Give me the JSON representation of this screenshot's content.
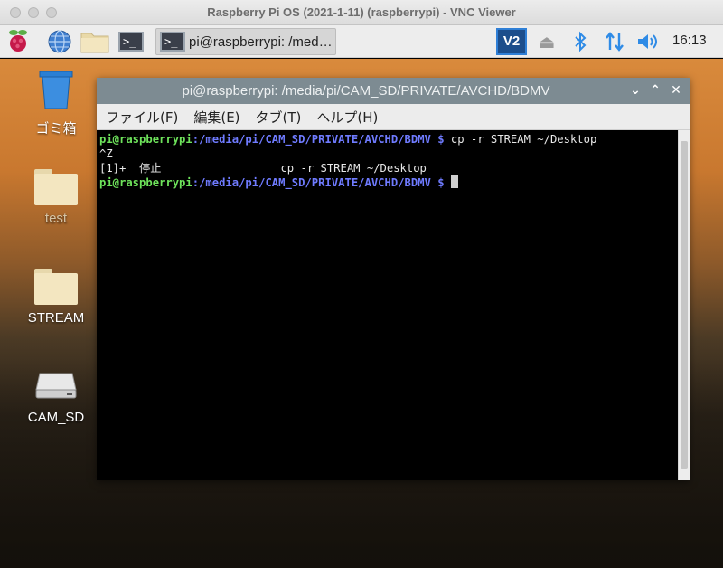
{
  "viewer": {
    "title": "Raspberry Pi OS (2021-1-11) (raspberrypi) - VNC Viewer"
  },
  "panel": {
    "task_label": "pi@raspberrypi: /med…",
    "terminal_icon_text": ">_",
    "vnc_label": "V2",
    "clock": "16:13"
  },
  "desktop": {
    "icons": [
      {
        "label": "ゴミ箱",
        "icon": "trash-icon"
      },
      {
        "label": "test",
        "icon": "folder-icon"
      },
      {
        "label": "STREAM",
        "icon": "folder-icon"
      },
      {
        "label": "CAM_SD",
        "icon": "drive-icon"
      }
    ]
  },
  "window": {
    "title": "pi@raspberrypi: /media/pi/CAM_SD/PRIVATE/AVCHD/BDMV",
    "menu": [
      "ファイル(F)",
      "編集(E)",
      "タブ(T)",
      "ヘルプ(H)"
    ]
  },
  "terminal": {
    "line1": {
      "user": "pi@raspberrypi",
      "path": ":/media/pi/CAM_SD/PRIVATE/AVCHD/BDMV $",
      "cmd": " cp -r STREAM ~/Desktop"
    },
    "line2": "^Z",
    "line3": "[1]+  停止                  cp -r STREAM ~/Desktop",
    "line4": {
      "user": "pi@raspberrypi",
      "path": ":/media/pi/CAM_SD/PRIVATE/AVCHD/BDMV $"
    }
  }
}
